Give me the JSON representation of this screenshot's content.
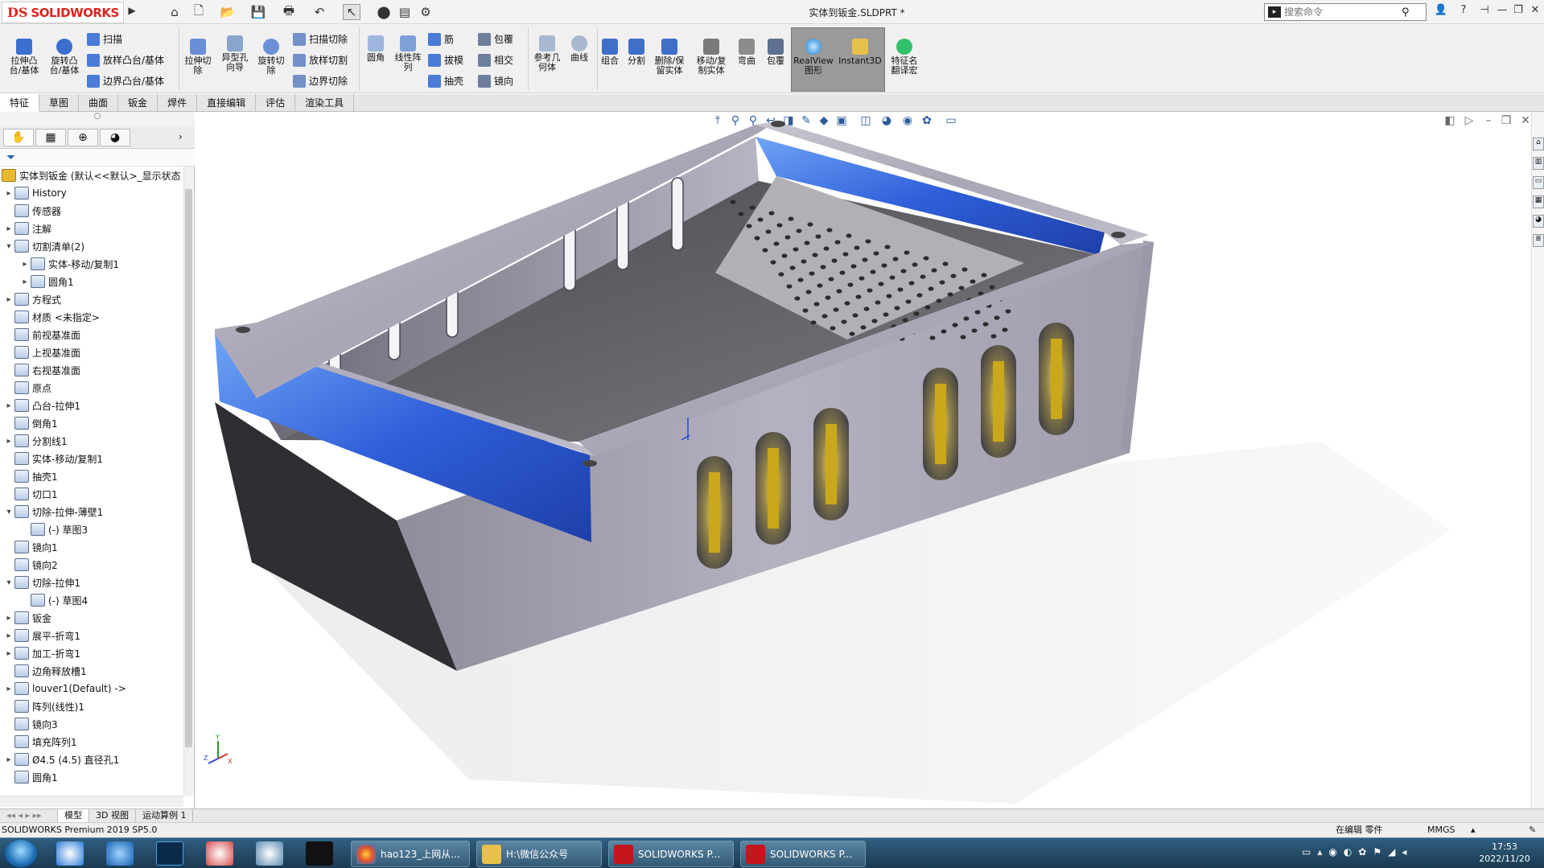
{
  "titlebar": {
    "logo_ds": "DS",
    "logo_name": "SOLIDWORKS",
    "doc_title": "实体到钣金.SLDPRT *",
    "search_placeholder": "搜索命令",
    "icons": [
      "home-icon",
      "new-icon",
      "open-icon",
      "save-icon",
      "print-icon",
      "undo-icon",
      "select-icon",
      "traffic-light-icon",
      "file-props-icon",
      "options-gear-icon"
    ]
  },
  "ribbon": {
    "big_buttons": [
      {
        "label": "拉伸凸\n台/基体",
        "icon": "extrude-boss-icon"
      },
      {
        "label": "旋转凸\n台/基体",
        "icon": "revolve-boss-icon"
      },
      {
        "label": "拉伸切\n除",
        "icon": "extrude-cut-icon"
      },
      {
        "label": "异型孔\n向导",
        "icon": "hole-wizard-icon"
      },
      {
        "label": "旋转切\n除",
        "icon": "revolve-cut-icon"
      },
      {
        "label": "圆角",
        "icon": "fillet-icon"
      },
      {
        "label": "线性阵\n列",
        "icon": "linear-pattern-icon"
      },
      {
        "label": "参考几\n何体",
        "icon": "reference-geometry-icon"
      },
      {
        "label": "曲线",
        "icon": "curves-icon"
      },
      {
        "label": "组合",
        "icon": "combine-icon"
      },
      {
        "label": "分割",
        "icon": "split-icon"
      },
      {
        "label": "删除/保\n留实体",
        "icon": "delete-body-icon"
      },
      {
        "label": "移动/复\n制实体",
        "icon": "move-copy-body-icon"
      },
      {
        "label": "弯曲",
        "icon": "flex-icon"
      },
      {
        "label": "包覆",
        "icon": "wrap-big-icon"
      },
      {
        "label": "RealView\n图形",
        "icon": "realview-icon"
      },
      {
        "label": "Instant3D",
        "icon": "instant3d-icon"
      },
      {
        "label": "特征名\n翻译宏",
        "icon": "translate-macro-icon"
      }
    ],
    "small_buttons": [
      {
        "label": "扫描",
        "icon": "sweep-icon"
      },
      {
        "label": "放样凸台/基体",
        "icon": "loft-boss-icon"
      },
      {
        "label": "边界凸台/基体",
        "icon": "boundary-boss-icon"
      },
      {
        "label": "扫描切除",
        "icon": "swept-cut-icon"
      },
      {
        "label": "放样切割",
        "icon": "lofted-cut-icon"
      },
      {
        "label": "边界切除",
        "icon": "boundary-cut-icon"
      },
      {
        "label": "筋",
        "icon": "rib-icon"
      },
      {
        "label": "拔模",
        "icon": "draft-icon"
      },
      {
        "label": "抽壳",
        "icon": "shell-icon"
      },
      {
        "label": "包覆",
        "icon": "wrap-icon"
      },
      {
        "label": "相交",
        "icon": "intersect-icon"
      },
      {
        "label": "镜向",
        "icon": "mirror-icon"
      }
    ]
  },
  "cm_tabs": [
    "特征",
    "草图",
    "曲面",
    "钣金",
    "焊件",
    "直接编辑",
    "评估",
    "渲染工具"
  ],
  "tree": {
    "root": "实体到钣金 (默认<<默认>_显示状态",
    "items": [
      {
        "label": "History",
        "depth": 0,
        "expand": "▸"
      },
      {
        "label": "传感器",
        "depth": 0,
        "expand": ""
      },
      {
        "label": "注解",
        "depth": 0,
        "expand": "▸"
      },
      {
        "label": "切割清单(2)",
        "depth": 0,
        "expand": "▾"
      },
      {
        "label": "实体-移动/复制1",
        "depth": 1,
        "expand": "▸"
      },
      {
        "label": "圆角1",
        "depth": 1,
        "expand": "▸"
      },
      {
        "label": "方程式",
        "depth": 0,
        "expand": "▸"
      },
      {
        "label": "材质 <未指定>",
        "depth": 0,
        "expand": ""
      },
      {
        "label": "前视基准面",
        "depth": 0,
        "expand": ""
      },
      {
        "label": "上视基准面",
        "depth": 0,
        "expand": ""
      },
      {
        "label": "右视基准面",
        "depth": 0,
        "expand": ""
      },
      {
        "label": "原点",
        "depth": 0,
        "expand": ""
      },
      {
        "label": "凸台-拉伸1",
        "depth": 0,
        "expand": "▸"
      },
      {
        "label": "倒角1",
        "depth": 0,
        "expand": ""
      },
      {
        "label": "分割线1",
        "depth": 0,
        "expand": "▸"
      },
      {
        "label": "实体-移动/复制1",
        "depth": 0,
        "expand": ""
      },
      {
        "label": "抽壳1",
        "depth": 0,
        "expand": ""
      },
      {
        "label": "切口1",
        "depth": 0,
        "expand": ""
      },
      {
        "label": "切除-拉伸-薄壁1",
        "depth": 0,
        "expand": "▾"
      },
      {
        "label": "(-) 草图3",
        "depth": 1,
        "expand": ""
      },
      {
        "label": "镜向1",
        "depth": 0,
        "expand": ""
      },
      {
        "label": "镜向2",
        "depth": 0,
        "expand": ""
      },
      {
        "label": "切除-拉伸1",
        "depth": 0,
        "expand": "▾"
      },
      {
        "label": "(-) 草图4",
        "depth": 1,
        "expand": ""
      },
      {
        "label": "钣金",
        "depth": 0,
        "expand": "▸"
      },
      {
        "label": "展平-折弯1",
        "depth": 0,
        "expand": "▸"
      },
      {
        "label": "加工-折弯1",
        "depth": 0,
        "expand": "▸"
      },
      {
        "label": "边角释放槽1",
        "depth": 0,
        "expand": ""
      },
      {
        "label": "louver1(Default) ->",
        "depth": 0,
        "expand": "▸"
      },
      {
        "label": "阵列(线性)1",
        "depth": 0,
        "expand": ""
      },
      {
        "label": "镜向3",
        "depth": 0,
        "expand": ""
      },
      {
        "label": "填充阵列1",
        "depth": 0,
        "expand": ""
      },
      {
        "label": "Ø4.5 (4.5) 直径孔1",
        "depth": 0,
        "expand": "▸"
      },
      {
        "label": "圆角1",
        "depth": 0,
        "expand": ""
      }
    ]
  },
  "triad": {
    "x": "X",
    "y": "Y",
    "z": "Z"
  },
  "bottom_tabs": [
    "模型",
    "3D 视图",
    "运动算例 1"
  ],
  "status": {
    "product": "SOLIDWORKS Premium 2019 SP5.0",
    "editing": "在编辑 零件",
    "units": "MMGS"
  },
  "taskbar": {
    "tasks": [
      {
        "label": "hao123_上网从...",
        "icon": "browser-icon",
        "color": "#e0532f"
      },
      {
        "label": "H:\\微信公众号",
        "icon": "folder-icon",
        "color": "#e8c04a"
      },
      {
        "label": "SOLIDWORKS P...",
        "icon": "solidworks-icon",
        "color": "#c4161c"
      },
      {
        "label": "SOLIDWORKS P...",
        "icon": "solidworks-icon",
        "color": "#c4161c"
      }
    ],
    "time": "17:53",
    "date": "2022/11/20"
  },
  "colors": {
    "ribbon_bg": "#f0f0f0",
    "brand_red": "#d9251d",
    "blue_face": "#2e5fd8",
    "steel": "#b9b6c2"
  }
}
